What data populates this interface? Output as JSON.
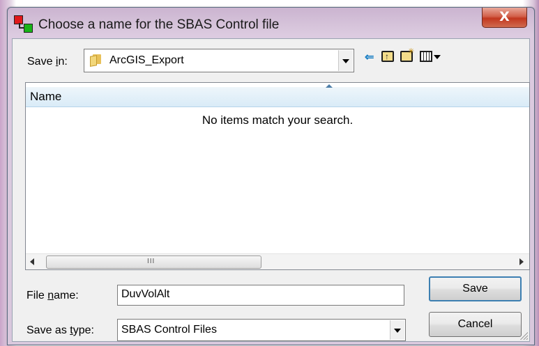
{
  "window": {
    "title": "Choose a name for the SBAS Control file",
    "close_label": "X"
  },
  "save_in": {
    "label": "Save in:",
    "value": "ArcGIS_Export"
  },
  "toolbar": {
    "back_icon": "back-arrow-icon",
    "up_icon": "up-folder-icon",
    "new_folder_icon": "new-folder-icon",
    "views_icon": "view-menu-icon"
  },
  "list": {
    "column_name": "Name",
    "empty_message": "No items match your search.",
    "scroll_grip": "III"
  },
  "file_name": {
    "label": "File name:",
    "value": "DuvVolAlt"
  },
  "save_as_type": {
    "label": "Save as type:",
    "value": "SBAS Control Files"
  },
  "buttons": {
    "save": "Save",
    "cancel": "Cancel"
  }
}
